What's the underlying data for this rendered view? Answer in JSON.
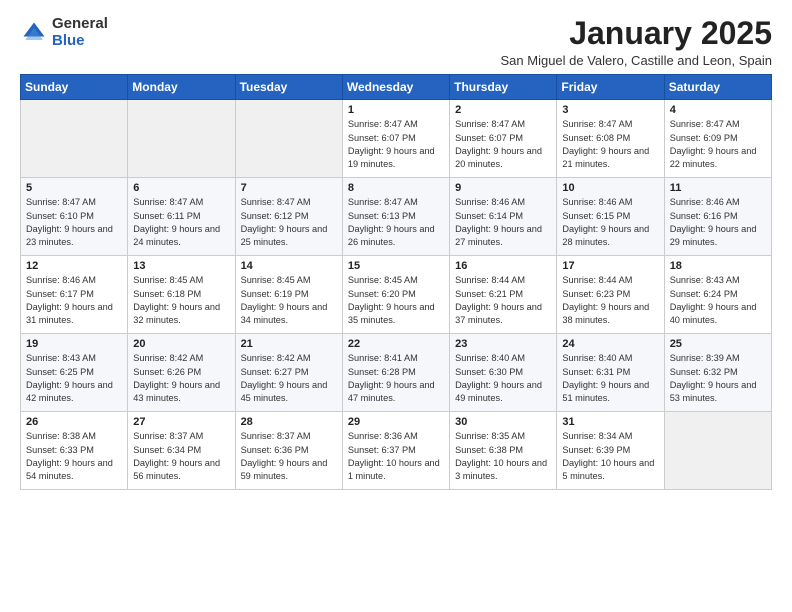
{
  "logo": {
    "general": "General",
    "blue": "Blue"
  },
  "title": "January 2025",
  "subtitle": "San Miguel de Valero, Castille and Leon, Spain",
  "headers": [
    "Sunday",
    "Monday",
    "Tuesday",
    "Wednesday",
    "Thursday",
    "Friday",
    "Saturday"
  ],
  "weeks": [
    [
      {
        "day": "",
        "empty": true
      },
      {
        "day": "",
        "empty": true
      },
      {
        "day": "",
        "empty": true
      },
      {
        "day": "1",
        "sunrise": "8:47 AM",
        "sunset": "6:07 PM",
        "daylight": "9 hours and 19 minutes."
      },
      {
        "day": "2",
        "sunrise": "8:47 AM",
        "sunset": "6:07 PM",
        "daylight": "9 hours and 20 minutes."
      },
      {
        "day": "3",
        "sunrise": "8:47 AM",
        "sunset": "6:08 PM",
        "daylight": "9 hours and 21 minutes."
      },
      {
        "day": "4",
        "sunrise": "8:47 AM",
        "sunset": "6:09 PM",
        "daylight": "9 hours and 22 minutes."
      }
    ],
    [
      {
        "day": "5",
        "sunrise": "8:47 AM",
        "sunset": "6:10 PM",
        "daylight": "9 hours and 23 minutes."
      },
      {
        "day": "6",
        "sunrise": "8:47 AM",
        "sunset": "6:11 PM",
        "daylight": "9 hours and 24 minutes."
      },
      {
        "day": "7",
        "sunrise": "8:47 AM",
        "sunset": "6:12 PM",
        "daylight": "9 hours and 25 minutes."
      },
      {
        "day": "8",
        "sunrise": "8:47 AM",
        "sunset": "6:13 PM",
        "daylight": "9 hours and 26 minutes."
      },
      {
        "day": "9",
        "sunrise": "8:46 AM",
        "sunset": "6:14 PM",
        "daylight": "9 hours and 27 minutes."
      },
      {
        "day": "10",
        "sunrise": "8:46 AM",
        "sunset": "6:15 PM",
        "daylight": "9 hours and 28 minutes."
      },
      {
        "day": "11",
        "sunrise": "8:46 AM",
        "sunset": "6:16 PM",
        "daylight": "9 hours and 29 minutes."
      }
    ],
    [
      {
        "day": "12",
        "sunrise": "8:46 AM",
        "sunset": "6:17 PM",
        "daylight": "9 hours and 31 minutes."
      },
      {
        "day": "13",
        "sunrise": "8:45 AM",
        "sunset": "6:18 PM",
        "daylight": "9 hours and 32 minutes."
      },
      {
        "day": "14",
        "sunrise": "8:45 AM",
        "sunset": "6:19 PM",
        "daylight": "9 hours and 34 minutes."
      },
      {
        "day": "15",
        "sunrise": "8:45 AM",
        "sunset": "6:20 PM",
        "daylight": "9 hours and 35 minutes."
      },
      {
        "day": "16",
        "sunrise": "8:44 AM",
        "sunset": "6:21 PM",
        "daylight": "9 hours and 37 minutes."
      },
      {
        "day": "17",
        "sunrise": "8:44 AM",
        "sunset": "6:23 PM",
        "daylight": "9 hours and 38 minutes."
      },
      {
        "day": "18",
        "sunrise": "8:43 AM",
        "sunset": "6:24 PM",
        "daylight": "9 hours and 40 minutes."
      }
    ],
    [
      {
        "day": "19",
        "sunrise": "8:43 AM",
        "sunset": "6:25 PM",
        "daylight": "9 hours and 42 minutes."
      },
      {
        "day": "20",
        "sunrise": "8:42 AM",
        "sunset": "6:26 PM",
        "daylight": "9 hours and 43 minutes."
      },
      {
        "day": "21",
        "sunrise": "8:42 AM",
        "sunset": "6:27 PM",
        "daylight": "9 hours and 45 minutes."
      },
      {
        "day": "22",
        "sunrise": "8:41 AM",
        "sunset": "6:28 PM",
        "daylight": "9 hours and 47 minutes."
      },
      {
        "day": "23",
        "sunrise": "8:40 AM",
        "sunset": "6:30 PM",
        "daylight": "9 hours and 49 minutes."
      },
      {
        "day": "24",
        "sunrise": "8:40 AM",
        "sunset": "6:31 PM",
        "daylight": "9 hours and 51 minutes."
      },
      {
        "day": "25",
        "sunrise": "8:39 AM",
        "sunset": "6:32 PM",
        "daylight": "9 hours and 53 minutes."
      }
    ],
    [
      {
        "day": "26",
        "sunrise": "8:38 AM",
        "sunset": "6:33 PM",
        "daylight": "9 hours and 54 minutes."
      },
      {
        "day": "27",
        "sunrise": "8:37 AM",
        "sunset": "6:34 PM",
        "daylight": "9 hours and 56 minutes."
      },
      {
        "day": "28",
        "sunrise": "8:37 AM",
        "sunset": "6:36 PM",
        "daylight": "9 hours and 59 minutes."
      },
      {
        "day": "29",
        "sunrise": "8:36 AM",
        "sunset": "6:37 PM",
        "daylight": "10 hours and 1 minute."
      },
      {
        "day": "30",
        "sunrise": "8:35 AM",
        "sunset": "6:38 PM",
        "daylight": "10 hours and 3 minutes."
      },
      {
        "day": "31",
        "sunrise": "8:34 AM",
        "sunset": "6:39 PM",
        "daylight": "10 hours and 5 minutes."
      },
      {
        "day": "",
        "empty": true
      }
    ]
  ]
}
